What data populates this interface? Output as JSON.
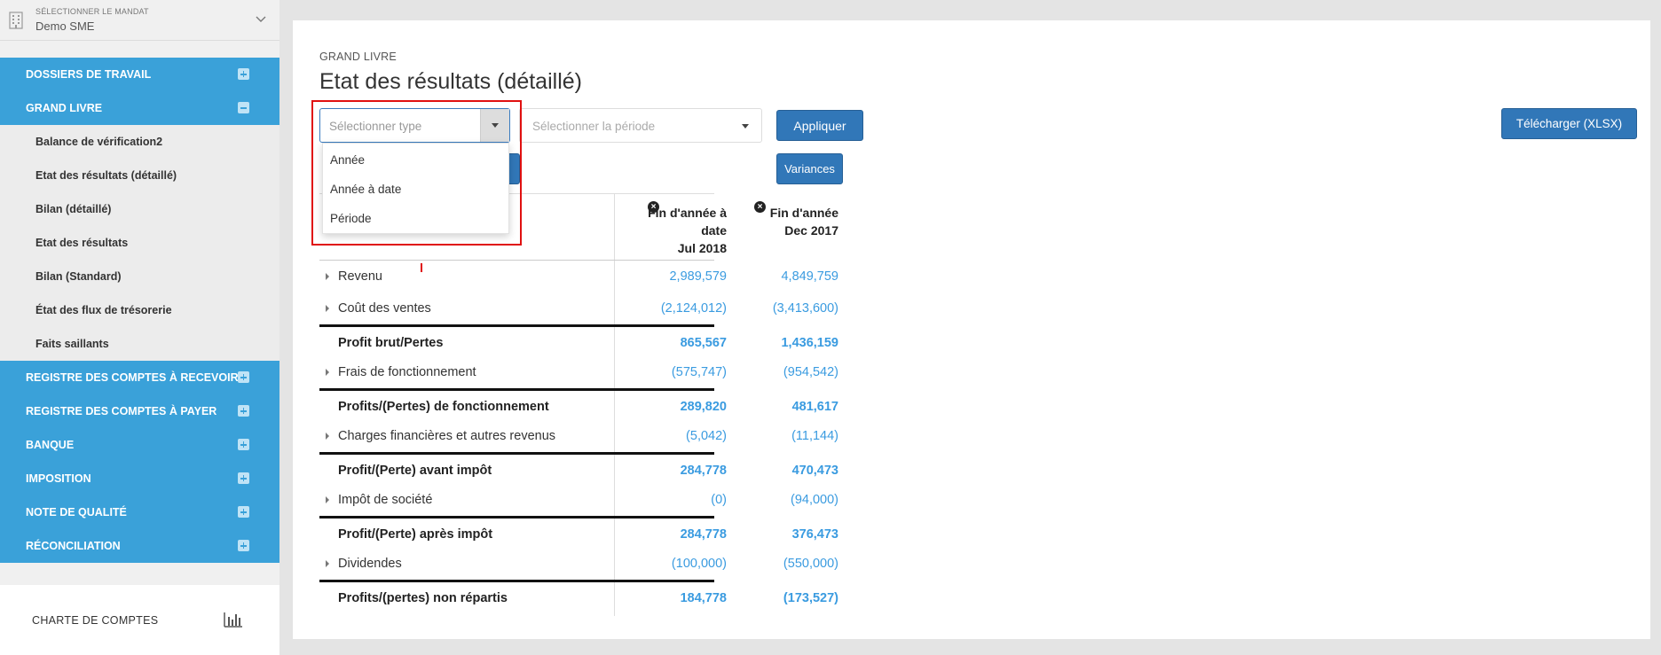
{
  "sidebar": {
    "mandat_label": "SÉLECTIONNER LE MANDAT",
    "mandat_value": "Demo SME",
    "sections": [
      {
        "label": "DOSSIERS DE TRAVAIL",
        "expanded": false
      },
      {
        "label": "GRAND LIVRE",
        "expanded": true,
        "items": [
          "Balance de vérification2",
          "Etat des résultats (détaillé)",
          "Bilan (détaillé)",
          "Etat des résultats",
          "Bilan (Standard)",
          "État des flux de trésorerie",
          "Faits saillants"
        ]
      },
      {
        "label": "REGISTRE DES COMPTES À RECEVOIR",
        "expanded": false
      },
      {
        "label": "REGISTRE DES COMPTES À PAYER",
        "expanded": false
      },
      {
        "label": "BANQUE",
        "expanded": false
      },
      {
        "label": "IMPOSITION",
        "expanded": false
      },
      {
        "label": "NOTE DE QUALITÉ",
        "expanded": false
      },
      {
        "label": "RÉCONCILIATION",
        "expanded": false
      }
    ],
    "chart_link": "CHARTE DE COMPTES",
    "chart_icon": "bar-chart-icon"
  },
  "main": {
    "breadcrumb": "GRAND LIVRE",
    "title": "Etat des résultats (détaillé)",
    "type_placeholder": "Sélectionner type",
    "period_placeholder": "Sélectionner la période",
    "apply_label": "Appliquer",
    "download_label": "Télécharger (XLSX)",
    "variances_label": "Variances",
    "dropdown_options": [
      "Année",
      "Année à date",
      "Période"
    ]
  },
  "table": {
    "columns": [
      {
        "line1": "Fin d'année à",
        "line2": "date",
        "line3": "Jul 2018"
      },
      {
        "line1": "Fin d'année",
        "line2": "Dec 2017"
      }
    ],
    "rows": [
      {
        "label": "Revenu",
        "total": false,
        "v1": "2,989,579",
        "v2": "4,849,759"
      },
      {
        "label": "Coût des ventes",
        "total": false,
        "v1": "(2,124,012)",
        "v2": "(3,413,600)"
      },
      {
        "label": "Profit brut/Pertes",
        "total": true,
        "v1": "865,567",
        "v2": "1,436,159"
      },
      {
        "label": "Frais de fonctionnement",
        "total": false,
        "v1": "(575,747)",
        "v2": "(954,542)"
      },
      {
        "label": "Profits/(Pertes) de fonctionnement",
        "total": true,
        "v1": "289,820",
        "v2": "481,617"
      },
      {
        "label": "Charges financières et autres revenus",
        "total": false,
        "v1": "(5,042)",
        "v2": "(11,144)"
      },
      {
        "label": "Profit/(Perte) avant impôt",
        "total": true,
        "v1": "284,778",
        "v2": "470,473"
      },
      {
        "label": "Impôt de société",
        "total": false,
        "v1": "(0)",
        "v2": "(94,000)"
      },
      {
        "label": "Profit/(Perte) après impôt",
        "total": true,
        "v1": "284,778",
        "v2": "376,473"
      },
      {
        "label": "Dividendes",
        "total": false,
        "v1": "(100,000)",
        "v2": "(550,000)"
      },
      {
        "label": "Profits/(pertes) non répartis",
        "total": true,
        "v1": "184,778",
        "v2": "(173,527)"
      }
    ]
  },
  "colors": {
    "sidebar_blue": "#3aa1d9",
    "button_blue": "#3177b8",
    "value_blue": "#3a9be0",
    "highlight_red": "#e01010"
  }
}
